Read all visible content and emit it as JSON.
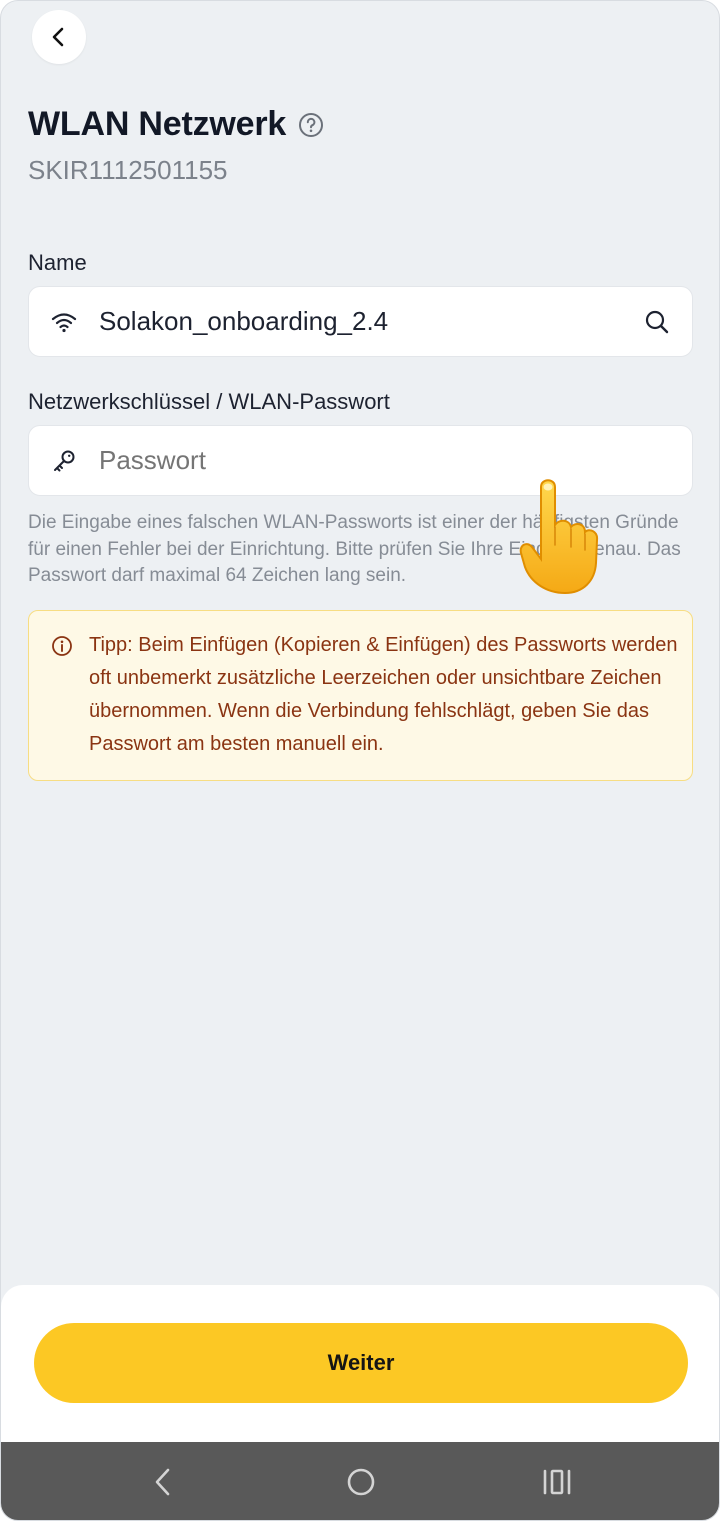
{
  "header": {
    "title": "WLAN Netzwerk",
    "serial": "SKIR1112501155"
  },
  "form": {
    "name_label": "Name",
    "name_value": "Solakon_onboarding_2.4",
    "password_label": "Netzwerkschlüssel / WLAN-Passwort",
    "password_placeholder": "Passwort",
    "hint": "Die Eingabe eines falschen WLAN-Passworts ist einer der häufigsten Gründe für einen Fehler bei der Einrichtung. Bitte prüfen Sie Ihre Eingabe genau. Das Passwort darf maximal 64 Zeichen lang sein."
  },
  "tip": {
    "text": "Tipp: Beim Einfügen (Kopieren & Einfügen) des Passworts werden oft unbemerkt zusätzliche Leerzeichen oder unsichtbare Zeichen übernommen. Wenn die Verbindung fehlschlägt, geben Sie das Passwort am besten manuell ein."
  },
  "footer": {
    "continue_label": "Weiter"
  },
  "icons": {
    "back": "chevron-left-icon",
    "help": "question-circle-icon",
    "wifi": "wifi-icon",
    "search": "search-icon",
    "key": "key-icon",
    "info": "info-circle-icon",
    "pointer": "pointing-hand-icon"
  },
  "colors": {
    "background": "#edf0f3",
    "accent": "#fcc824",
    "tip_background": "#fef9e6",
    "tip_border": "#f7dd83",
    "tip_text": "#8a3412"
  }
}
